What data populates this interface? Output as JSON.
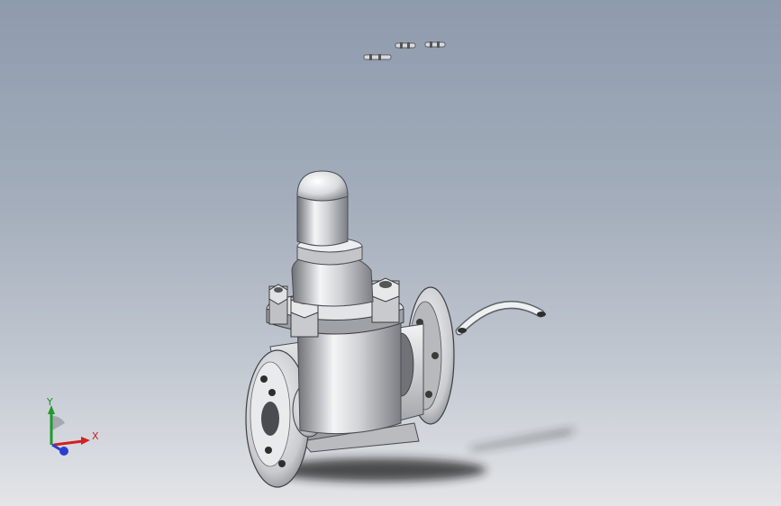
{
  "viewport": {
    "background_top": "#8e9bad",
    "background_bottom": "#e3e5e8"
  },
  "triad": {
    "x_label": "X",
    "y_label": "Y",
    "x_color": "#d42020",
    "y_color": "#1f9a2c",
    "z_color": "#2a3fd0"
  },
  "model": {
    "body_color": "#cfd1d4",
    "shadow_color": "#1a1a1a"
  }
}
